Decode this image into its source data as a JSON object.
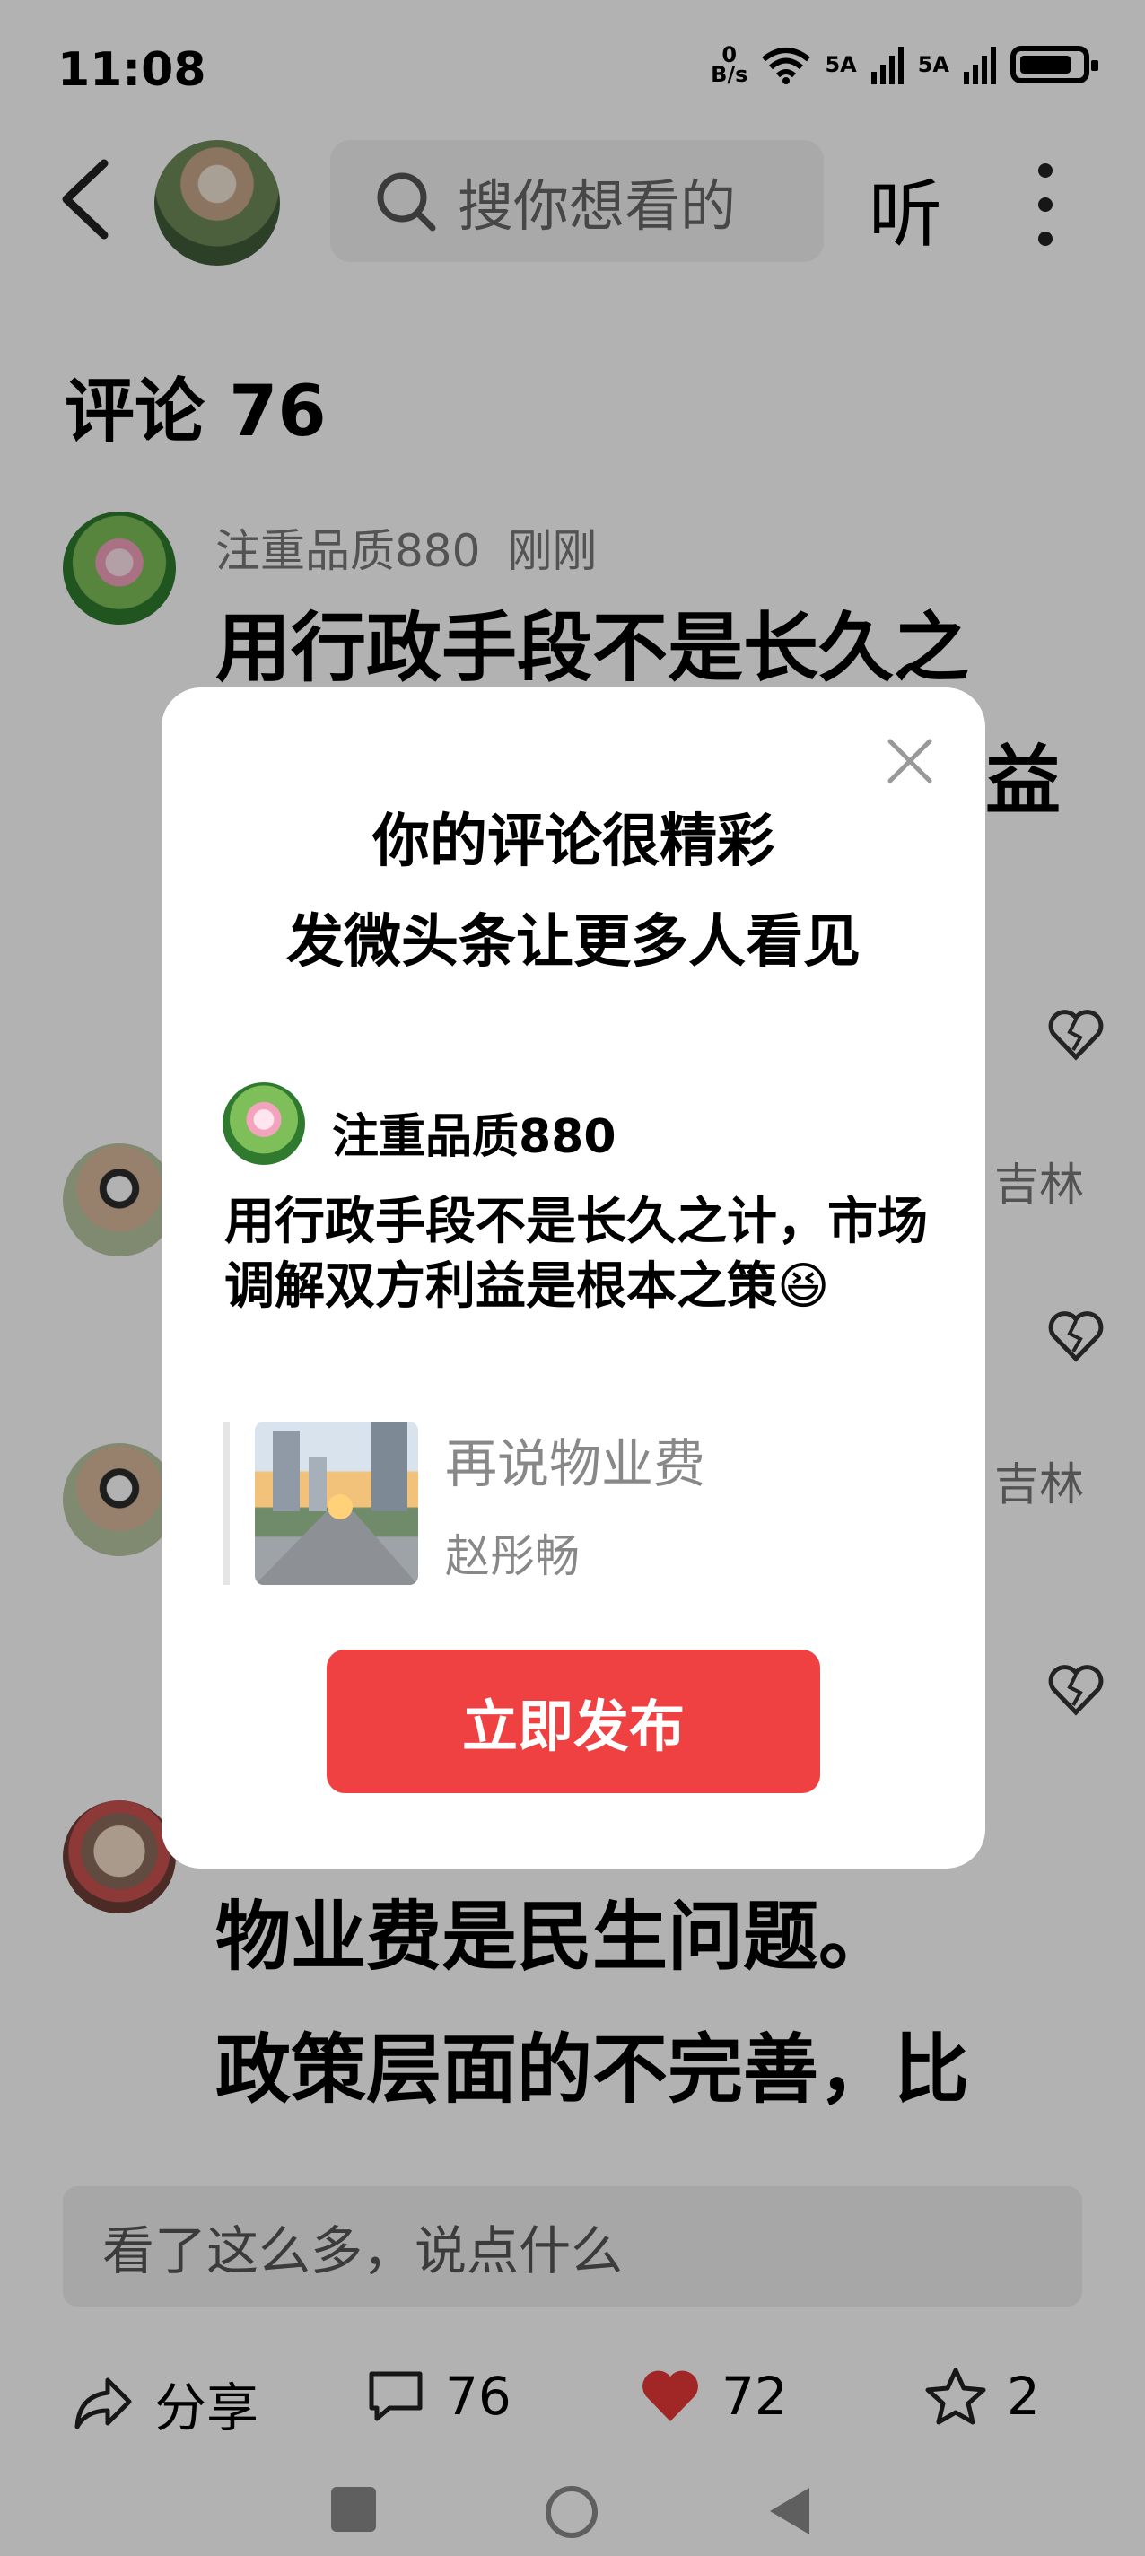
{
  "status_bar": {
    "time": "11:08",
    "net_speed_top": "0",
    "net_speed_unit": "B/s",
    "signal1": "5A",
    "signal2": "5A"
  },
  "header": {
    "search_placeholder": "搜你想看的",
    "listen_label": "听"
  },
  "comments_section": {
    "title": "评论 76",
    "comments": [
      {
        "username": "注重品质880",
        "time": "刚刚",
        "line1": "用行政手段不是长久之",
        "line2_tail": "益"
      },
      {
        "username_tail": "吉林"
      },
      {
        "username_tail": "吉林"
      },
      {
        "line1": "物业费是民生问题。",
        "line2": "政策层面的不完善，比"
      }
    ]
  },
  "modal": {
    "title_line1": "你的评论很精彩",
    "title_line2": "发微头条让更多人看见",
    "username": "注重品质880",
    "body": "用行政手段不是长久之计，市场调解双方利益是根本之策",
    "emoji": "😆",
    "article_title": "再说物业费",
    "article_author": "赵彤畅",
    "publish_label": "立即发布"
  },
  "input": {
    "placeholder": "看了这么多，说点什么"
  },
  "bottom_bar": {
    "share_label": "分享",
    "comment_count": "76",
    "like_count": "72",
    "favorite_count": "2"
  },
  "colors": {
    "accent": "#f04142",
    "like": "#e53935"
  }
}
